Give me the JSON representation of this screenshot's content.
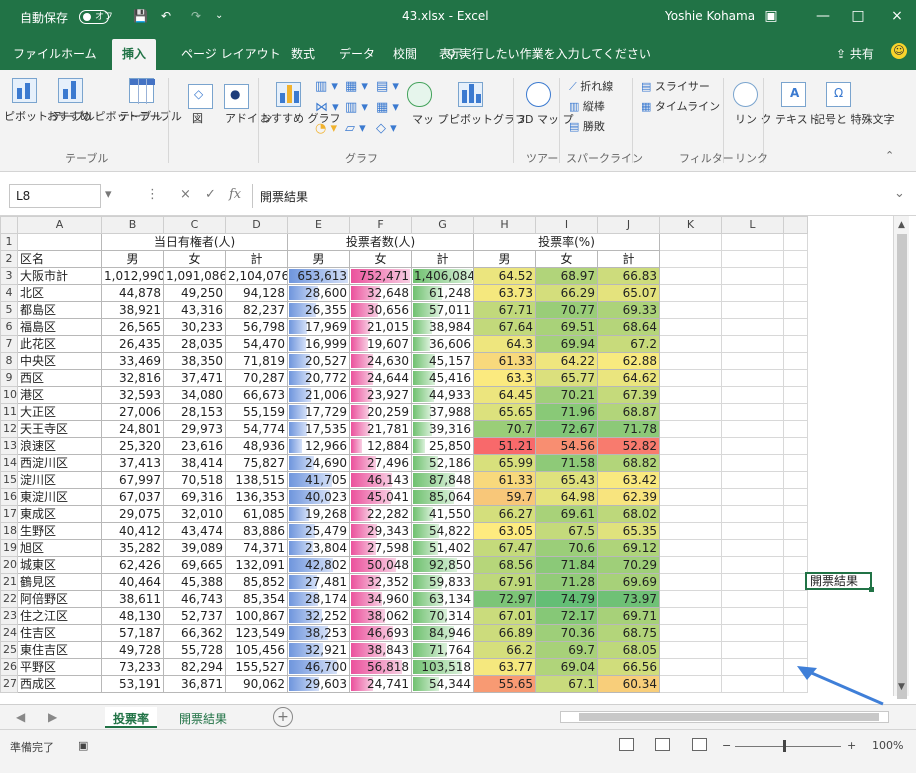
{
  "titlebar": {
    "autosave": "自動保存",
    "autosave_state": "オフ",
    "file_title": "43.xlsx - Excel",
    "user": "Yoshie Kohama"
  },
  "menu_tabs": [
    "ファイル",
    "ホーム",
    "挿入",
    "ページ レイアウト",
    "数式",
    "データ",
    "校閲",
    "表示"
  ],
  "active_tab": "挿入",
  "tellme": "実行したい作業を入力してください",
  "share": "共有",
  "ribbon": {
    "groups": [
      "テーブル",
      "グラフ",
      "ツアー",
      "スパークライン",
      "フィルター",
      "リンク"
    ],
    "buttons": {
      "pivot": "ピボット\nテーブル",
      "recommended_pivot": "おすすめ\nピボットテーブル",
      "table": "テーブル",
      "illustration": "図",
      "addin": "アドイ\nン",
      "recommended_chart": "おすすめ\nグラフ",
      "map": "マッ\nプ",
      "pivot_chart": "ピボットグラフ",
      "map3d": "3D マッ\nプ",
      "line_spark": "折れ線",
      "column_spark": "縦棒",
      "winloss": "勝敗",
      "slicer": "スライサー",
      "timeline": "タイムライン",
      "link": "リン\nク",
      "text": "テキスト",
      "symbol": "記号と\n特殊文字"
    }
  },
  "formula_bar": {
    "name_box": "L8",
    "value": "開票結果"
  },
  "columns": [
    "A",
    "B",
    "C",
    "D",
    "E",
    "F",
    "G",
    "H",
    "I",
    "J",
    "K",
    "L"
  ],
  "headers": {
    "b1": "当日有権者(人)",
    "e1": "投票者数(人)",
    "h1": "投票率(%)",
    "a2": "区名",
    "sub": [
      "男",
      "女",
      "計",
      "男",
      "女",
      "計",
      "男",
      "女",
      "計"
    ]
  },
  "rows": [
    [
      "大阪市計",
      "1,012,990",
      "1,091,086",
      "2,104,076",
      "653,613",
      "752,471",
      "1,406,084",
      "64.52",
      "68.97",
      "66.83"
    ],
    [
      "北区",
      "44,878",
      "49,250",
      "94,128",
      "28,600",
      "32,648",
      "61,248",
      "63.73",
      "66.29",
      "65.07"
    ],
    [
      "都島区",
      "38,921",
      "43,316",
      "82,237",
      "26,355",
      "30,656",
      "57,011",
      "67.71",
      "70.77",
      "69.33"
    ],
    [
      "福島区",
      "26,565",
      "30,233",
      "56,798",
      "17,969",
      "21,015",
      "38,984",
      "67.64",
      "69.51",
      "68.64"
    ],
    [
      "此花区",
      "26,435",
      "28,035",
      "54,470",
      "16,999",
      "19,607",
      "36,606",
      "64.3",
      "69.94",
      "67.2"
    ],
    [
      "中央区",
      "33,469",
      "38,350",
      "71,819",
      "20,527",
      "24,630",
      "45,157",
      "61.33",
      "64.22",
      "62.88"
    ],
    [
      "西区",
      "32,816",
      "37,471",
      "70,287",
      "20,772",
      "24,644",
      "45,416",
      "63.3",
      "65.77",
      "64.62"
    ],
    [
      "港区",
      "32,593",
      "34,080",
      "66,673",
      "21,006",
      "23,927",
      "44,933",
      "64.45",
      "70.21",
      "67.39"
    ],
    [
      "大正区",
      "27,006",
      "28,153",
      "55,159",
      "17,729",
      "20,259",
      "37,988",
      "65.65",
      "71.96",
      "68.87"
    ],
    [
      "天王寺区",
      "24,801",
      "29,973",
      "54,774",
      "17,535",
      "21,781",
      "39,316",
      "70.7",
      "72.67",
      "71.78"
    ],
    [
      "浪速区",
      "25,320",
      "23,616",
      "48,936",
      "12,966",
      "12,884",
      "25,850",
      "51.21",
      "54.56",
      "52.82"
    ],
    [
      "西淀川区",
      "37,413",
      "38,414",
      "75,827",
      "24,690",
      "27,496",
      "52,186",
      "65.99",
      "71.58",
      "68.82"
    ],
    [
      "淀川区",
      "67,997",
      "70,518",
      "138,515",
      "41,705",
      "46,143",
      "87,848",
      "61.33",
      "65.43",
      "63.42"
    ],
    [
      "東淀川区",
      "67,037",
      "69,316",
      "136,353",
      "40,023",
      "45,041",
      "85,064",
      "59.7",
      "64.98",
      "62.39"
    ],
    [
      "東成区",
      "29,075",
      "32,010",
      "61,085",
      "19,268",
      "22,282",
      "41,550",
      "66.27",
      "69.61",
      "68.02"
    ],
    [
      "生野区",
      "40,412",
      "43,474",
      "83,886",
      "25,479",
      "29,343",
      "54,822",
      "63.05",
      "67.5",
      "65.35"
    ],
    [
      "旭区",
      "35,282",
      "39,089",
      "74,371",
      "23,804",
      "27,598",
      "51,402",
      "67.47",
      "70.6",
      "69.12"
    ],
    [
      "城東区",
      "62,426",
      "69,665",
      "132,091",
      "42,802",
      "50,048",
      "92,850",
      "68.56",
      "71.84",
      "70.29"
    ],
    [
      "鶴見区",
      "40,464",
      "45,388",
      "85,852",
      "27,481",
      "32,352",
      "59,833",
      "67.91",
      "71.28",
      "69.69"
    ],
    [
      "阿倍野区",
      "38,611",
      "46,743",
      "85,354",
      "28,174",
      "34,960",
      "63,134",
      "72.97",
      "74.79",
      "73.97"
    ],
    [
      "住之江区",
      "48,130",
      "52,737",
      "100,867",
      "32,252",
      "38,062",
      "70,314",
      "67.01",
      "72.17",
      "69.71"
    ],
    [
      "住吉区",
      "57,187",
      "66,362",
      "123,549",
      "38,253",
      "46,693",
      "84,946",
      "66.89",
      "70.36",
      "68.75"
    ],
    [
      "東住吉区",
      "49,728",
      "55,728",
      "105,456",
      "32,921",
      "38,843",
      "71,764",
      "66.2",
      "69.7",
      "68.05"
    ],
    [
      "平野区",
      "73,233",
      "82,294",
      "155,527",
      "46,700",
      "56,818",
      "103,518",
      "63.77",
      "69.04",
      "66.56"
    ],
    [
      "西成区",
      "53,191",
      "36,871",
      "90,062",
      "29,603",
      "24,741",
      "54,344",
      "55.65",
      "67.1",
      "60.34"
    ]
  ],
  "cell_l8": "開票結果",
  "sheets": [
    "投票率",
    "開票結果"
  ],
  "active_sheet": "投票率",
  "status": {
    "ready": "準備完了",
    "zoom": "100%"
  },
  "colors": {
    "excel_green": "#217346",
    "blue_bar": "#5b87d8",
    "pink_bar": "#e83a8f",
    "green_bar": "#5cb85c"
  }
}
